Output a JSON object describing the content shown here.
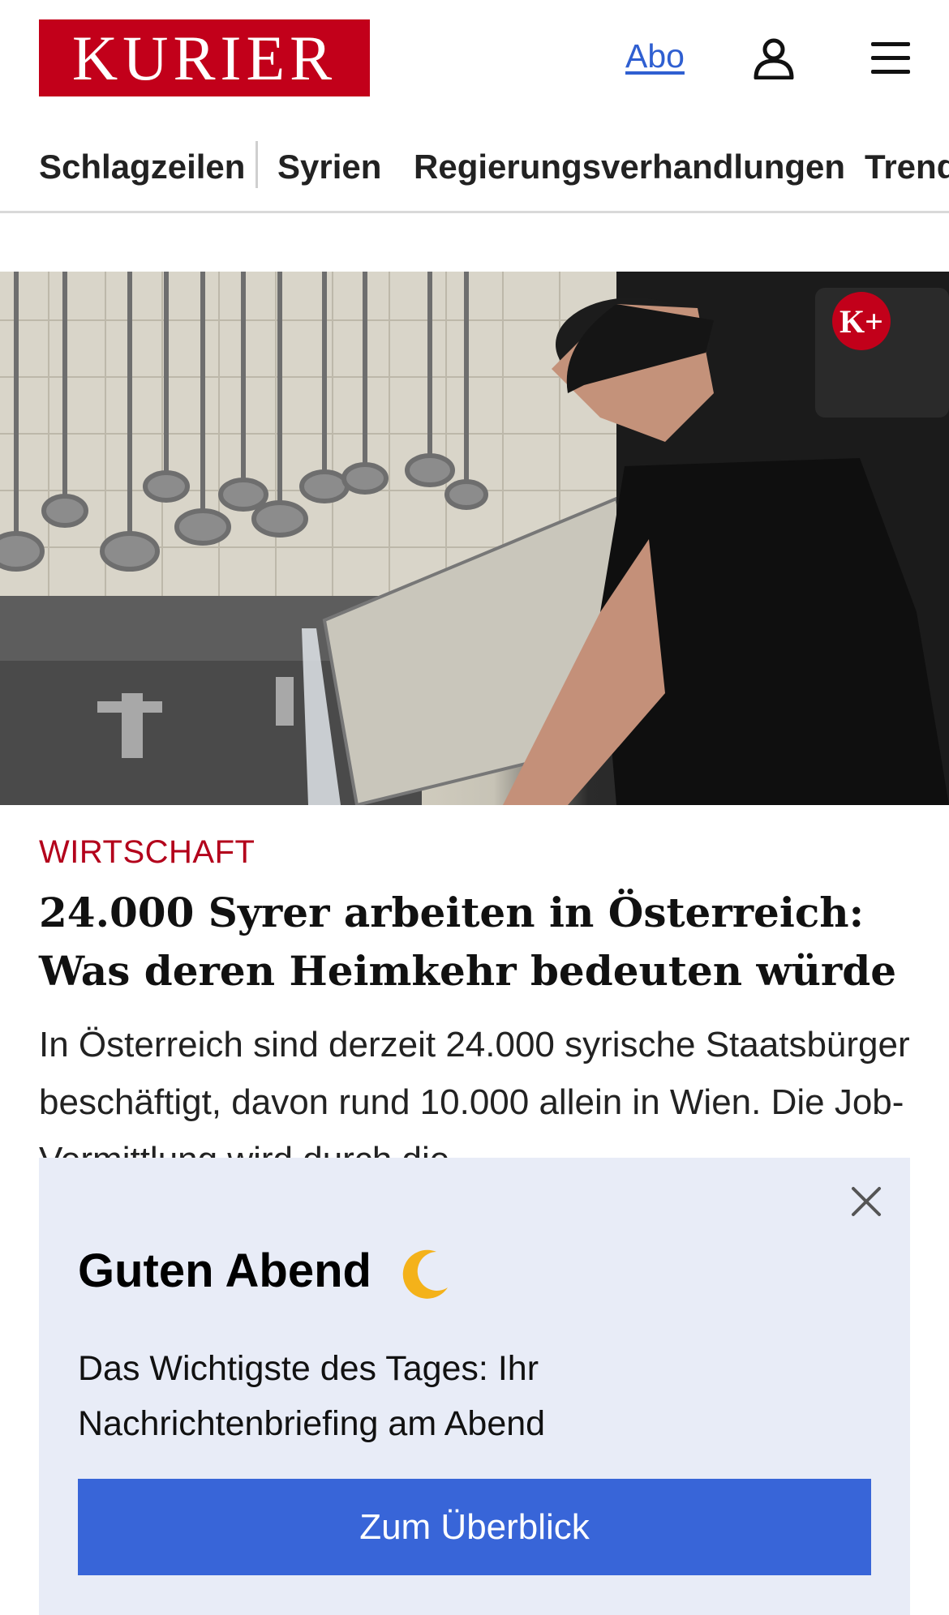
{
  "header": {
    "logo_text": "KURIER",
    "abo_label": "Abo",
    "account_icon": "user-icon",
    "menu_icon": "hamburger-menu-icon"
  },
  "nav": {
    "items": [
      "Schlagzeilen",
      "Syrien",
      "Regierungsverhandlungen",
      "Trend"
    ]
  },
  "hero": {
    "badge_text": "K+"
  },
  "article": {
    "category": "WIRTSCHAFT",
    "headline": "24.000 Syrer arbeiten in Österreich: Was deren Heimkehr bedeuten würde",
    "teaser": "In Österreich sind derzeit 24.000 syrische Staatsbürger beschäftigt, davon rund 10.000 allein in Wien. Die Job-Vermittlung wird durch die"
  },
  "popup": {
    "title": "Guten Abend",
    "title_icon": "crescent-moon-icon",
    "text": "Das Wichtigste des Tages: Ihr Nachrichtenbriefing am Abend",
    "button_label": "Zum Überblick",
    "close_icon": "close-icon"
  },
  "colors": {
    "brand": "#c2001a",
    "link": "#2f5fd1",
    "category": "#b3001b",
    "popup_bg": "#e8ecf7",
    "button": "#3865d8"
  }
}
